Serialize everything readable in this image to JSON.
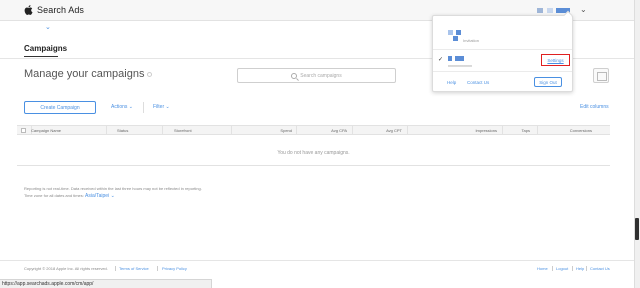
{
  "header": {
    "brand": "Search Ads",
    "chevron": "⌄"
  },
  "tabs": [
    {
      "label": "Campaigns",
      "active": true
    }
  ],
  "page": {
    "heading": "Manage your campaigns",
    "search_placeholder": "Search campaigns"
  },
  "actions": {
    "create": "Create Campaign",
    "actions": "Actions",
    "filter": "Filter",
    "edit_columns": "Edit columns"
  },
  "table": {
    "columns": [
      "Campaign Name",
      "Status",
      "Storefront",
      "Spend",
      "Avg CPA",
      "Avg CPT",
      "Impressions",
      "Taps",
      "Conversions"
    ],
    "empty_message": "You do not have any campaigns."
  },
  "notes": {
    "line1": "Reporting is not real-time. Data received within the last three hours may not be reflected in reporting.",
    "line2": "Time zone for all dates and times:",
    "timezone": "Asia/Taipei"
  },
  "footer": {
    "copyright": "Copyright © 2018 Apple Inc. All rights reserved.",
    "links_left": [
      "Terms of Service",
      "Privacy Policy"
    ],
    "links_right": [
      "Home",
      "Logout",
      "Help",
      "Contact Us"
    ]
  },
  "status_bar": {
    "url": "https://app.searchads.apple.com/cm/app/"
  },
  "account_menu": {
    "account1_sub": "Invitation",
    "account2_sub": "xxxxxxxxxxxx",
    "settings": "Settings",
    "help": "Help",
    "contact": "Contact Us",
    "sign_out": "Sign Out"
  },
  "colors": {
    "accent": "#4a90e2",
    "highlight_box": "#e02020",
    "avatar_blue": "#5b8dd6",
    "avatar_light": "#a9c4ec"
  },
  "icons": [
    "apple-icon",
    "search-icon",
    "chevron-down-icon",
    "check-icon",
    "calendar-icon"
  ]
}
